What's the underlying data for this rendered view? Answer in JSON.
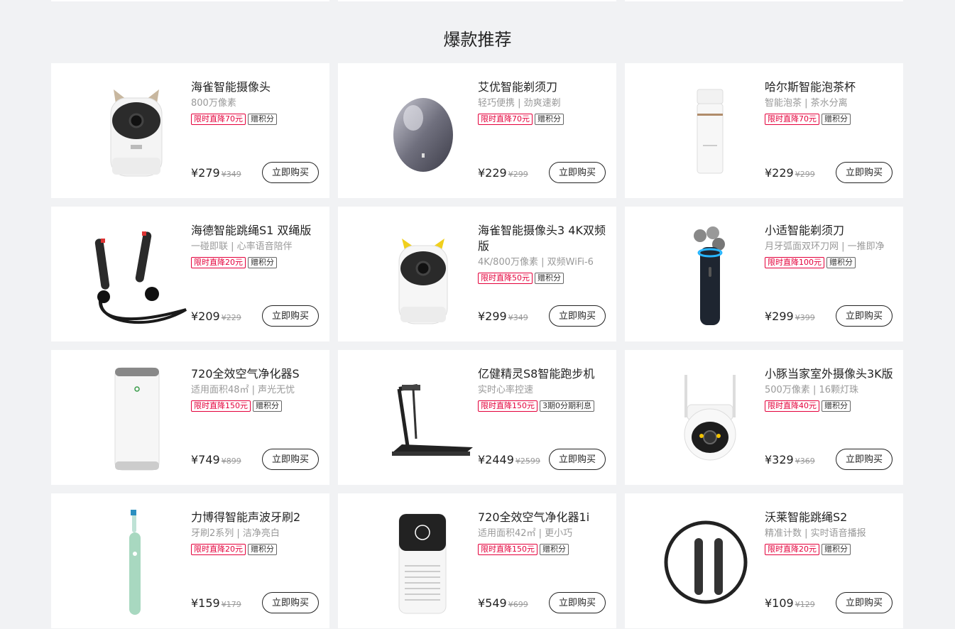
{
  "section": {
    "title": "爆款推荐"
  },
  "colors": {
    "accent": "#e4003b",
    "background": "#f1f2f4",
    "card": "#ffffff",
    "text": "#222222"
  },
  "buy_label": "立即购买",
  "products": [
    {
      "name": "海雀智能摄像头",
      "desc": "800万像素",
      "tags": [
        "限时直降70元",
        "赠积分"
      ],
      "price": "¥279",
      "original_price": "¥349",
      "icon": "camera-icon"
    },
    {
      "name": "艾优智能剃须刀",
      "desc": "轻巧便携 | 劲爽速剃",
      "tags": [
        "限时直降70元",
        "赠积分"
      ],
      "price": "¥229",
      "original_price": "¥299",
      "icon": "shaver-egg-icon"
    },
    {
      "name": "哈尔斯智能泡茶杯",
      "desc": "智能泡茶 | 茶水分离",
      "tags": [
        "限时直降70元",
        "赠积分"
      ],
      "price": "¥229",
      "original_price": "¥299",
      "icon": "tea-cup-icon"
    },
    {
      "name": "海德智能跳绳S1 双绳版",
      "desc": "一碰即联 | 心率语音陪伴",
      "tags": [
        "限时直降20元",
        "赠积分"
      ],
      "price": "¥209",
      "original_price": "¥229",
      "icon": "jump-rope-icon"
    },
    {
      "name": "海雀智能摄像头3 4K双频版",
      "desc": "4K/800万像素 | 双频WiFi-6",
      "tags": [
        "限时直降50元",
        "赠积分"
      ],
      "price": "¥299",
      "original_price": "¥349",
      "icon": "camera-yellow-icon"
    },
    {
      "name": "小适智能剃须刀",
      "desc": "月牙弧面双环刀网 | 一推即净",
      "tags": [
        "限时直降100元",
        "赠积分"
      ],
      "price": "¥299",
      "original_price": "¥399",
      "icon": "shaver-icon"
    },
    {
      "name": "720全效空气净化器S",
      "desc": "适用面积48㎡ | 声光无忧",
      "tags": [
        "限时直降150元",
        "赠积分"
      ],
      "price": "¥749",
      "original_price": "¥899",
      "icon": "air-purifier-icon"
    },
    {
      "name": "亿健精灵S8智能跑步机",
      "desc": "实时心率控速",
      "tags": [
        "限时直降150元",
        "3期0分期利息"
      ],
      "price": "¥2449",
      "original_price": "¥2599",
      "icon": "treadmill-icon"
    },
    {
      "name": "小豚当家室外摄像头3K版",
      "desc": "500万像素 | 16颗灯珠",
      "tags": [
        "限时直降40元",
        "赠积分"
      ],
      "price": "¥329",
      "original_price": "¥369",
      "icon": "outdoor-camera-icon"
    },
    {
      "name": "力博得智能声波牙刷2",
      "desc": "牙刷2系列 | 洁净亮白",
      "tags": [
        "限时直降20元",
        "赠积分"
      ],
      "price": "¥159",
      "original_price": "¥179",
      "icon": "toothbrush-icon"
    },
    {
      "name": "720全效空气净化器1i",
      "desc": "适用面积42㎡ | 更小巧",
      "tags": [
        "限时直降150元",
        "赠积分"
      ],
      "price": "¥549",
      "original_price": "¥699",
      "icon": "air-purifier-display-icon"
    },
    {
      "name": "沃莱智能跳绳S2",
      "desc": "精准计数 | 实时语音播报",
      "tags": [
        "限时直降20元",
        "赠积分"
      ],
      "price": "¥109",
      "original_price": "¥129",
      "icon": "jump-rope-ring-icon"
    }
  ]
}
